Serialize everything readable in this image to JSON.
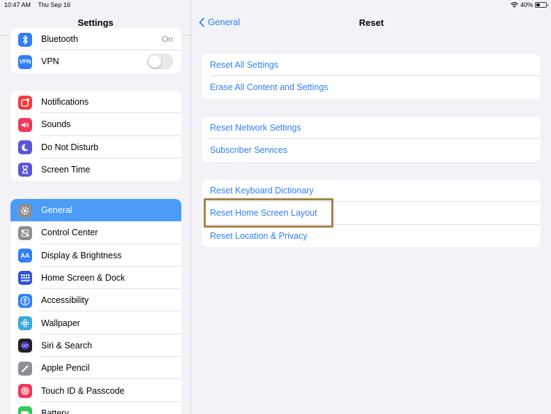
{
  "status": {
    "time": "10:47 AM",
    "date": "Thu Sep 16",
    "battery": "40%",
    "battery_level": 0.4
  },
  "sidebar": {
    "title": "Settings",
    "group1": [
      {
        "label": "Bluetooth",
        "value": "On",
        "icon": "bluetooth-icon",
        "color": "#2f7ff5"
      },
      {
        "label": "VPN",
        "icon": "vpn-icon",
        "color": "#2f7ff5",
        "badge": "VPN"
      }
    ],
    "group2": [
      {
        "label": "Notifications",
        "icon": "notifications-icon",
        "color": "#f23b3b"
      },
      {
        "label": "Sounds",
        "icon": "sounds-icon",
        "color": "#f0385a"
      },
      {
        "label": "Do Not Disturb",
        "icon": "moon-icon",
        "color": "#5b56d6"
      },
      {
        "label": "Screen Time",
        "icon": "hourglass-icon",
        "color": "#5b56d6"
      }
    ],
    "group3": [
      {
        "label": "General",
        "icon": "gear-icon",
        "color": "#8e8e93"
      },
      {
        "label": "Control Center",
        "icon": "control-center-icon",
        "color": "#8e8e93"
      },
      {
        "label": "Display & Brightness",
        "icon": "display-icon",
        "color": "#2f7ff5",
        "badge": "AA"
      },
      {
        "label": "Home Screen & Dock",
        "icon": "home-screen-icon",
        "color": "#2f55d4"
      },
      {
        "label": "Accessibility",
        "icon": "accessibility-icon",
        "color": "#2f7ff5"
      },
      {
        "label": "Wallpaper",
        "icon": "wallpaper-icon",
        "color": "#38aadc"
      },
      {
        "label": "Siri & Search",
        "icon": "siri-icon",
        "color": "#222"
      },
      {
        "label": "Apple Pencil",
        "icon": "pencil-icon",
        "color": "#8e8e93"
      },
      {
        "label": "Touch ID & Passcode",
        "icon": "fingerprint-icon",
        "color": "#f0385a"
      },
      {
        "label": "Battery",
        "icon": "battery-icon",
        "color": "#34c759"
      }
    ]
  },
  "detail": {
    "back_label": "General",
    "title": "Reset",
    "group1": [
      "Reset All Settings",
      "Erase All Content and Settings"
    ],
    "group2": [
      "Reset Network Settings",
      "Subscriber Services"
    ],
    "group3": [
      "Reset Keyboard Dictionary",
      "Reset Home Screen Layout",
      "Reset Location & Privacy"
    ]
  }
}
